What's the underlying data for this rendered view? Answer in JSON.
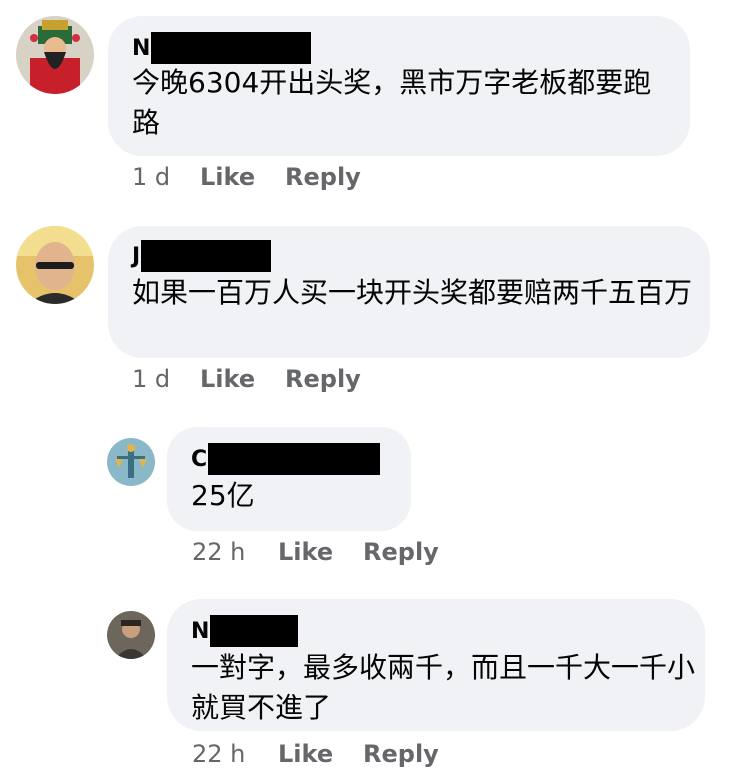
{
  "comments": [
    {
      "author_initial": "N",
      "text": "今晚6304开出头奖，黑市万字老板都要跑路",
      "time": "1 d",
      "like_label": "Like",
      "reply_label": "Reply",
      "avatar_icon": "god-of-fortune-avatar"
    },
    {
      "author_initial": "J",
      "text": "如果一百万人买一块开头奖都要赔两千五百万",
      "time": "1 d",
      "like_label": "Like",
      "reply_label": "Reply",
      "avatar_icon": "man-portrait-avatar"
    },
    {
      "author_initial": "C",
      "text": "25亿",
      "time": "22 h",
      "like_label": "Like",
      "reply_label": "Reply",
      "avatar_icon": "statue-avatar"
    },
    {
      "author_initial": "N",
      "text": "一對字，最多收兩千，而且一千大一千小就買不進了",
      "time": "22 h",
      "like_label": "Like",
      "reply_label": "Reply",
      "avatar_icon": "person-avatar"
    }
  ]
}
